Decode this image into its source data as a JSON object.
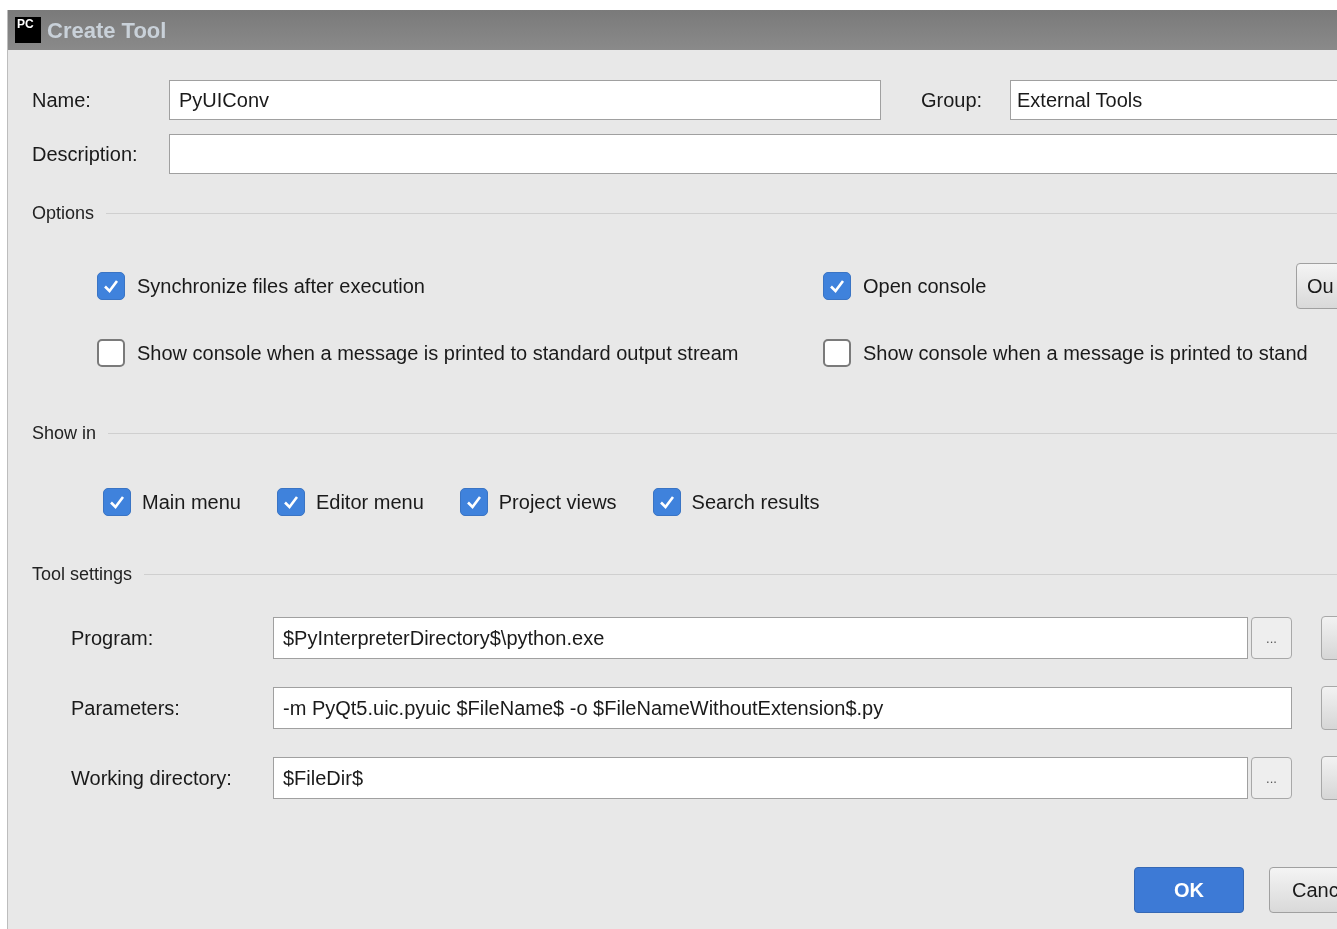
{
  "window": {
    "title": "Create Tool",
    "app_icon": "PC"
  },
  "name": {
    "label": "Name:",
    "value": "PyUIConv"
  },
  "group": {
    "label": "Group:",
    "value": "External Tools"
  },
  "description": {
    "label": "Description:"
  },
  "options": {
    "title": "Options",
    "checkboxes": [
      {
        "label": "Synchronize files after execution",
        "checked": true
      },
      {
        "label": "Open console",
        "checked": true
      },
      {
        "label": "Show console when a message is printed to standard output stream",
        "checked": false
      },
      {
        "label": "Show console when a message is printed to stand",
        "checked": false
      }
    ],
    "side_button": "Ou"
  },
  "show_in": {
    "title": "Show in",
    "checkboxes": [
      {
        "label": "Main menu",
        "checked": true
      },
      {
        "label": "Editor menu",
        "checked": true
      },
      {
        "label": "Project views",
        "checked": true
      },
      {
        "label": "Search results",
        "checked": true
      }
    ]
  },
  "tool_settings": {
    "title": "Tool settings",
    "fields": [
      {
        "label": "Program:",
        "value": "$PyInterpreterDirectory$\\python.exe",
        "browse": "..."
      },
      {
        "label": "Parameters:",
        "value": "-m PyQt5.uic.pyuic $FileName$ -o $FileNameWithoutExtension$.py"
      },
      {
        "label": "Working directory:",
        "value": "$FileDir$",
        "browse": "..."
      }
    ]
  },
  "buttons": [
    {
      "label": "OK",
      "kind": "primary"
    },
    {
      "label": "Canc",
      "kind": "secondary"
    }
  ]
}
